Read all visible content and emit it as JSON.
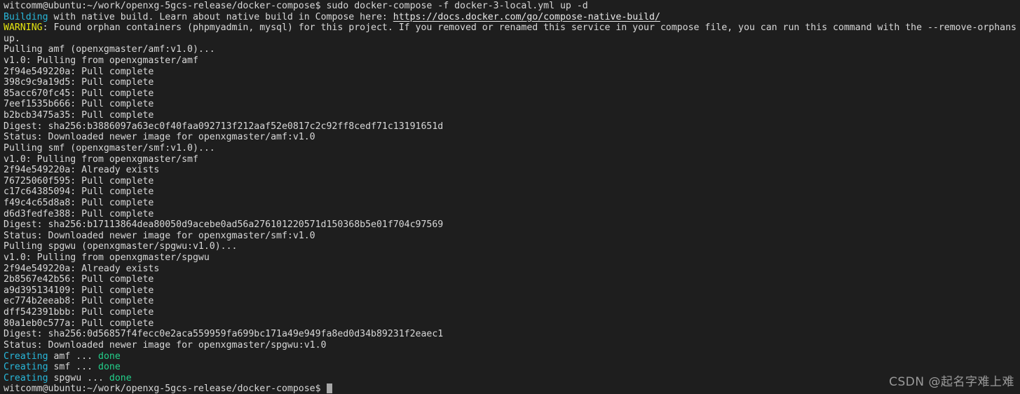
{
  "terminal": {
    "background_color": "#1e1e1e",
    "foreground_color": "#d8d8d8",
    "colors": {
      "cyan": "#29b8db",
      "yellow": "#e5e510",
      "green": "#23d18b",
      "link": "#e8e8e8",
      "cursor": "#a8a8a8"
    },
    "prompt": "witcomm@ubuntu:~/work/openxg-5gcs-release/docker-compose$",
    "command": "sudo docker-compose -f docker-3-local.yml up -d",
    "cursor_glyph": "block-cursor",
    "lines": [
      {
        "id": "line-command",
        "segments": [
          {
            "text": "witcomm@ubuntu:~/work/openxg-5gcs-release/docker-compose$ sudo docker-compose -f docker-3-local.yml up -d",
            "style": "default"
          }
        ]
      },
      {
        "id": "line-building",
        "segments": [
          {
            "text": "Building",
            "style": "cyan"
          },
          {
            "text": " with native build. Learn about native build in Compose here: ",
            "style": "default"
          },
          {
            "text": "https://docs.docker.com/go/compose-native-build/",
            "style": "link"
          }
        ]
      },
      {
        "id": "line-warning",
        "segments": [
          {
            "text": "WARNING",
            "style": "yellow"
          },
          {
            "text": ": Found orphan containers (phpmyadmin, mysql) for this project. If you removed or renamed this service in your compose file, you can run this command with the --remove-orphans",
            "style": "default"
          }
        ]
      },
      {
        "id": "line-warning-wrap",
        "segments": [
          {
            "text": "up.",
            "style": "default"
          }
        ]
      },
      {
        "id": "line-pull-amf",
        "segments": [
          {
            "text": "Pulling amf (openxgmaster/amf:v1.0)...",
            "style": "default"
          }
        ]
      },
      {
        "id": "line-amf-from",
        "segments": [
          {
            "text": "v1.0: Pulling from openxgmaster/amf",
            "style": "default"
          }
        ]
      },
      {
        "id": "line-amf-layer-1",
        "segments": [
          {
            "text": "2f94e549220a: Pull complete",
            "style": "default"
          }
        ]
      },
      {
        "id": "line-amf-layer-2",
        "segments": [
          {
            "text": "398c9c9a19d5: Pull complete",
            "style": "default"
          }
        ]
      },
      {
        "id": "line-amf-layer-3",
        "segments": [
          {
            "text": "85acc670fc45: Pull complete",
            "style": "default"
          }
        ]
      },
      {
        "id": "line-amf-layer-4",
        "segments": [
          {
            "text": "7eef1535b666: Pull complete",
            "style": "default"
          }
        ]
      },
      {
        "id": "line-amf-layer-5",
        "segments": [
          {
            "text": "b2bcb3475a35: Pull complete",
            "style": "default"
          }
        ]
      },
      {
        "id": "line-amf-digest",
        "segments": [
          {
            "text": "Digest: sha256:b3886097a63ec0f40faa092713f212aaf52e0817c2c92ff8cedf71c13191651d",
            "style": "default"
          }
        ]
      },
      {
        "id": "line-amf-status",
        "segments": [
          {
            "text": "Status: Downloaded newer image for openxgmaster/amf:v1.0",
            "style": "default"
          }
        ]
      },
      {
        "id": "line-pull-smf",
        "segments": [
          {
            "text": "Pulling smf (openxgmaster/smf:v1.0)...",
            "style": "default"
          }
        ]
      },
      {
        "id": "line-smf-from",
        "segments": [
          {
            "text": "v1.0: Pulling from openxgmaster/smf",
            "style": "default"
          }
        ]
      },
      {
        "id": "line-smf-layer-1",
        "segments": [
          {
            "text": "2f94e549220a: Already exists",
            "style": "default"
          }
        ]
      },
      {
        "id": "line-smf-layer-2",
        "segments": [
          {
            "text": "76725060f595: Pull complete",
            "style": "default"
          }
        ]
      },
      {
        "id": "line-smf-layer-3",
        "segments": [
          {
            "text": "c17c64385094: Pull complete",
            "style": "default"
          }
        ]
      },
      {
        "id": "line-smf-layer-4",
        "segments": [
          {
            "text": "f49c4c65d8a8: Pull complete",
            "style": "default"
          }
        ]
      },
      {
        "id": "line-smf-layer-5",
        "segments": [
          {
            "text": "d6d3fedfe388: Pull complete",
            "style": "default"
          }
        ]
      },
      {
        "id": "line-smf-digest",
        "segments": [
          {
            "text": "Digest: sha256:b17113864dea80050d9acebe0ad56a276101220571d150368b5e01f704c97569",
            "style": "default"
          }
        ]
      },
      {
        "id": "line-smf-status",
        "segments": [
          {
            "text": "Status: Downloaded newer image for openxgmaster/smf:v1.0",
            "style": "default"
          }
        ]
      },
      {
        "id": "line-pull-spgwu",
        "segments": [
          {
            "text": "Pulling spgwu (openxgmaster/spgwu:v1.0)...",
            "style": "default"
          }
        ]
      },
      {
        "id": "line-spgwu-from",
        "segments": [
          {
            "text": "v1.0: Pulling from openxgmaster/spgwu",
            "style": "default"
          }
        ]
      },
      {
        "id": "line-spgwu-layer-1",
        "segments": [
          {
            "text": "2f94e549220a: Already exists",
            "style": "default"
          }
        ]
      },
      {
        "id": "line-spgwu-layer-2",
        "segments": [
          {
            "text": "2b8567e42b56: Pull complete",
            "style": "default"
          }
        ]
      },
      {
        "id": "line-spgwu-layer-3",
        "segments": [
          {
            "text": "a9d395134109: Pull complete",
            "style": "default"
          }
        ]
      },
      {
        "id": "line-spgwu-layer-4",
        "segments": [
          {
            "text": "ec774b2eeab8: Pull complete",
            "style": "default"
          }
        ]
      },
      {
        "id": "line-spgwu-layer-5",
        "segments": [
          {
            "text": "dff542391bbb: Pull complete",
            "style": "default"
          }
        ]
      },
      {
        "id": "line-spgwu-layer-6",
        "segments": [
          {
            "text": "80a1eb0c577a: Pull complete",
            "style": "default"
          }
        ]
      },
      {
        "id": "line-spgwu-digest",
        "segments": [
          {
            "text": "Digest: sha256:0d56857f4fecc0e2aca559959fa699bc171a49e949fa8ed0d34b89231f2eaec1",
            "style": "default"
          }
        ]
      },
      {
        "id": "line-spgwu-status",
        "segments": [
          {
            "text": "Status: Downloaded newer image for openxgmaster/spgwu:v1.0",
            "style": "default"
          }
        ]
      },
      {
        "id": "line-creating-amf",
        "segments": [
          {
            "text": "Creating",
            "style": "cyan"
          },
          {
            "text": " amf ... ",
            "style": "default"
          },
          {
            "text": "done",
            "style": "green"
          }
        ]
      },
      {
        "id": "line-creating-smf",
        "segments": [
          {
            "text": "Creating",
            "style": "cyan"
          },
          {
            "text": " smf ... ",
            "style": "default"
          },
          {
            "text": "done",
            "style": "green"
          }
        ]
      },
      {
        "id": "line-creating-spgwu",
        "segments": [
          {
            "text": "Creating",
            "style": "cyan"
          },
          {
            "text": " spgwu ... ",
            "style": "default"
          },
          {
            "text": "done",
            "style": "green"
          }
        ]
      },
      {
        "id": "line-prompt",
        "has_cursor": true,
        "segments": [
          {
            "text": "witcomm@ubuntu:~/work/openxg-5gcs-release/docker-compose$ ",
            "style": "default"
          }
        ]
      }
    ]
  },
  "watermark": {
    "text": "CSDN @起名字难上难"
  }
}
